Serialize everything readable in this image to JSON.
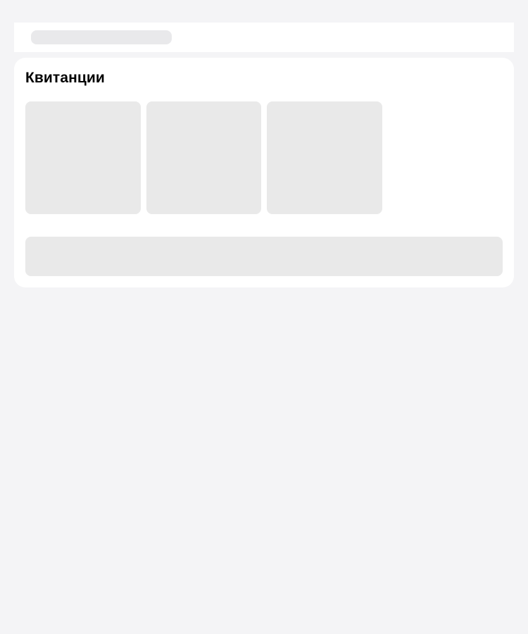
{
  "page": {
    "section_title": "Квитанции",
    "loading_tiles": 3
  },
  "colors": {
    "background": "#f4f4f6",
    "surface": "#ffffff",
    "skeleton": "#e9e9e9",
    "text": "#000000"
  }
}
